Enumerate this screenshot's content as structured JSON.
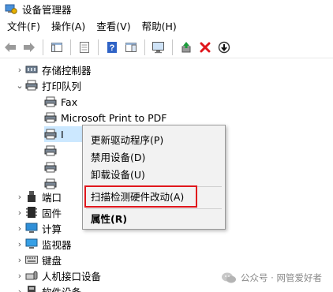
{
  "window": {
    "title": "设备管理器"
  },
  "menu": [
    "文件(F)",
    "操作(A)",
    "查看(V)",
    "帮助(H)"
  ],
  "tree": {
    "nodes": [
      {
        "label": "存储控制器",
        "expander": "›",
        "icon": "storage-controller-icon"
      },
      {
        "label": "打印队列",
        "expander": "⌄",
        "icon": "printer-icon"
      },
      {
        "label": "Fax",
        "icon": "printer-icon"
      },
      {
        "label": "Microsoft Print to PDF",
        "icon": "printer-icon"
      },
      {
        "label": "I",
        "icon": "printer-icon"
      },
      {
        "label": "",
        "icon": "printer-icon"
      },
      {
        "label": "",
        "icon": "printer-icon"
      },
      {
        "label": "",
        "icon": "printer-icon"
      },
      {
        "label": "端口",
        "expander": "›",
        "icon": "port-icon"
      },
      {
        "label": "固件",
        "expander": "›",
        "icon": "firmware-icon"
      },
      {
        "label": "计算",
        "expander": "›",
        "icon": "computer-icon"
      },
      {
        "label": "监视器",
        "expander": "›",
        "icon": "monitor-icon"
      },
      {
        "label": "键盘",
        "expander": "›",
        "icon": "keyboard-icon"
      },
      {
        "label": "人机接口设备",
        "expander": "›",
        "icon": "hid-icon"
      },
      {
        "label": "软件设备",
        "expander": "›",
        "icon": "software-device-icon"
      }
    ]
  },
  "context_menu": {
    "items": [
      {
        "label": "更新驱动程序(P)"
      },
      {
        "label": "禁用设备(D)"
      },
      {
        "label": "卸载设备(U)"
      },
      {
        "label": "扫描检测硬件改动(A)",
        "highlighted": true
      },
      {
        "label": "属性(R)",
        "bold": true
      }
    ],
    "highlight_color": "#e0161c"
  },
  "watermark": {
    "text": "公众号 · 网管爱好者"
  }
}
